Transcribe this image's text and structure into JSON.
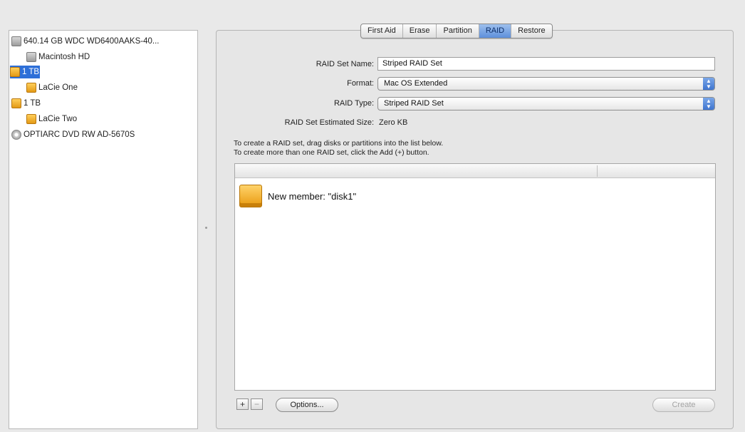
{
  "sidebar": {
    "items": [
      {
        "label": "640.14 GB WDC WD6400AAKS-40...",
        "icon": "hard-disk-icon"
      },
      {
        "label": "Macintosh HD",
        "icon": "volume-icon"
      },
      {
        "label": "1 TB",
        "icon": "external-disk-icon",
        "selected": true
      },
      {
        "label": "LaCie One",
        "icon": "external-volume-icon"
      },
      {
        "label": "1 TB",
        "icon": "external-disk-icon"
      },
      {
        "label": "LaCie Two",
        "icon": "external-volume-icon"
      },
      {
        "label": "OPTIARC DVD RW AD-5670S",
        "icon": "optical-drive-icon"
      }
    ]
  },
  "tabs": [
    "First Aid",
    "Erase",
    "Partition",
    "RAID",
    "Restore"
  ],
  "active_tab": "RAID",
  "raid": {
    "name_label": "RAID Set Name:",
    "name_value": "Striped RAID Set",
    "format_label": "Format:",
    "format_value": "Mac OS Extended",
    "type_label": "RAID Type:",
    "type_value": "Striped RAID Set",
    "size_label": "RAID Set Estimated Size:",
    "size_value": "Zero KB"
  },
  "instructions": {
    "line1": "To create a RAID set, drag disks or partitions into the list below.",
    "line2": "To create more than one RAID set, click the Add (+) button."
  },
  "members": [
    {
      "label": "New member: \"disk1\"",
      "icon": "external-disk-icon"
    }
  ],
  "buttons": {
    "add": "+",
    "remove": "−",
    "options": "Options...",
    "create": "Create"
  },
  "colors": {
    "selection": "#2d6fd8",
    "tab_active": "#5d8fdb",
    "disk_orange": "#e8990f"
  }
}
